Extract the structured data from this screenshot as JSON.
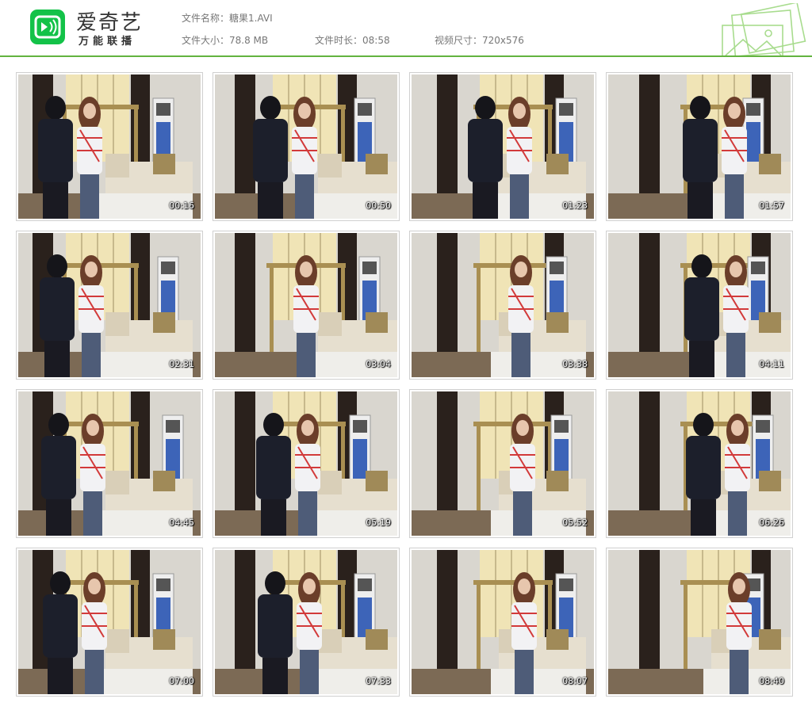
{
  "app": {
    "name": "爱奇艺",
    "subtitle": "万能联播",
    "logo_icon": "iqiyi-tv-icon",
    "accent": "#13c248"
  },
  "file": {
    "name_label": "文件名称：",
    "name": "糖果1.AVI",
    "size_label": "文件大小：",
    "size": "78.8 MB",
    "duration_label": "文件时长：",
    "duration": "08:58",
    "resolution_label": "视频尺寸：",
    "resolution": "720x576"
  },
  "thumbnails": [
    {
      "time": "00:16"
    },
    {
      "time": "00:50"
    },
    {
      "time": "01:23"
    },
    {
      "time": "01:57"
    },
    {
      "time": "02:31"
    },
    {
      "time": "03:04"
    },
    {
      "time": "03:38"
    },
    {
      "time": "04:11"
    },
    {
      "time": "04:45"
    },
    {
      "time": "05:19"
    },
    {
      "time": "05:52"
    },
    {
      "time": "06:26"
    },
    {
      "time": "07:00"
    },
    {
      "time": "07:33"
    },
    {
      "time": "08:07"
    },
    {
      "time": "08:40"
    }
  ]
}
